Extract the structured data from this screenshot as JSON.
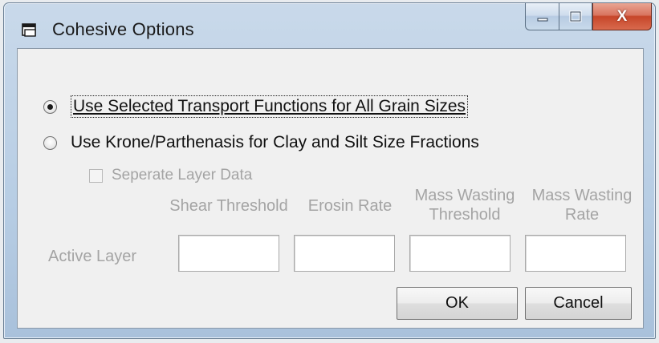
{
  "window": {
    "title": "Cohesive Options",
    "icon": "dialog-app-icon",
    "controls": {
      "minimize_icon": "minimize-icon",
      "maximize_icon": "maximize-icon",
      "close_label": "X"
    }
  },
  "options": {
    "option1": {
      "label": "Use Selected Transport Functions for All Grain Sizes",
      "checked": true
    },
    "option2": {
      "label": "Use Krone/Parthenasis for Clay and Silt Size Fractions",
      "checked": false
    }
  },
  "separate_layer": {
    "label": "Seperate Layer Data",
    "checked": false,
    "enabled": false
  },
  "columns": {
    "shear_threshold": "Shear Threshold",
    "erosion_rate": "Erosin Rate",
    "mass_wasting_threshold_1": "Mass Wasting",
    "mass_wasting_threshold_2": "Threshold",
    "mass_wasting_rate_1": "Mass Wasting",
    "mass_wasting_rate_2": "Rate"
  },
  "active_layer": {
    "label": "Active Layer",
    "shear_threshold": "",
    "erosion_rate": "",
    "mass_wasting_threshold": "",
    "mass_wasting_rate": ""
  },
  "buttons": {
    "ok": "OK",
    "cancel": "Cancel"
  },
  "colors": {
    "title_bar": "#b7cde4",
    "close_button": "#c7462a",
    "dialog_face": "#f0f0f0",
    "disabled_text": "#a4a4a4"
  }
}
